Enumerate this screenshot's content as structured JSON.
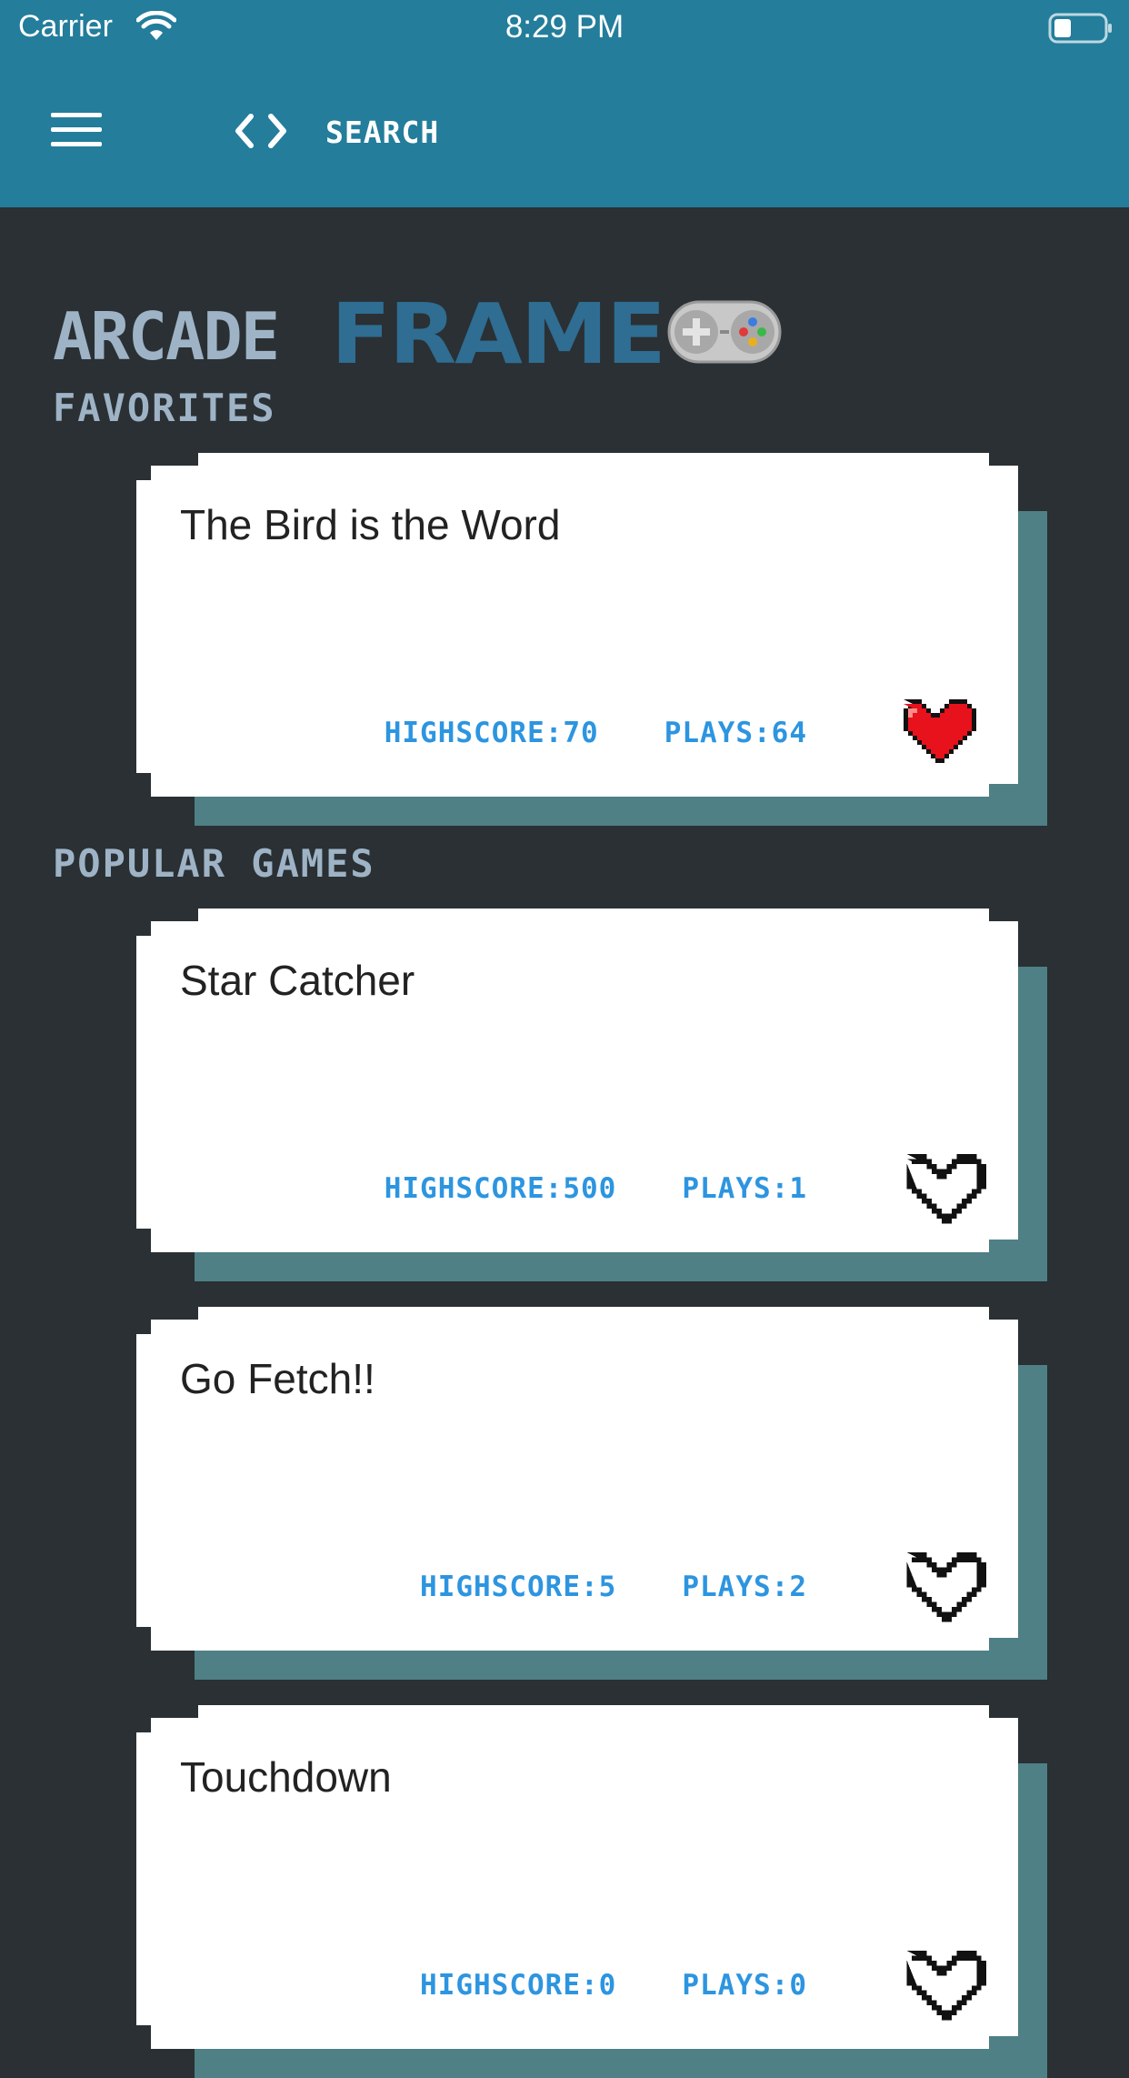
{
  "status_bar": {
    "carrier": "Carrier",
    "time": "8:29 PM"
  },
  "nav": {
    "search_label": "SEARCH"
  },
  "logo": {
    "part1": "ARCADE",
    "part2": "FRAME"
  },
  "sections": {
    "favorites": "FAVORITES",
    "popular": "POPULAR GAMES"
  },
  "favorites": [
    {
      "title": "The Bird is the Word",
      "highscore": "HIGHSCORE:70",
      "plays": "PLAYS:64",
      "favorited": true
    }
  ],
  "popular": [
    {
      "title": "Star Catcher",
      "highscore": "HIGHSCORE:500",
      "plays": "PLAYS:1",
      "favorited": false
    },
    {
      "title": "Go Fetch!!",
      "highscore": "HIGHSCORE:5",
      "plays": "PLAYS:2",
      "favorited": false
    },
    {
      "title": "Touchdown",
      "highscore": "HIGHSCORE:0",
      "plays": "PLAYS:0",
      "favorited": false
    }
  ],
  "colors": {
    "nav_bg": "#237d9b",
    "page_bg": "#2a3033",
    "card_shadow": "#4e8086",
    "stat_text": "#2d95e0",
    "heart_filled": "#e8121c"
  },
  "icons": [
    "wifi-icon",
    "battery-icon",
    "menu-icon",
    "code-icon",
    "controller-icon",
    "heart-filled-icon",
    "heart-outline-icon"
  ]
}
